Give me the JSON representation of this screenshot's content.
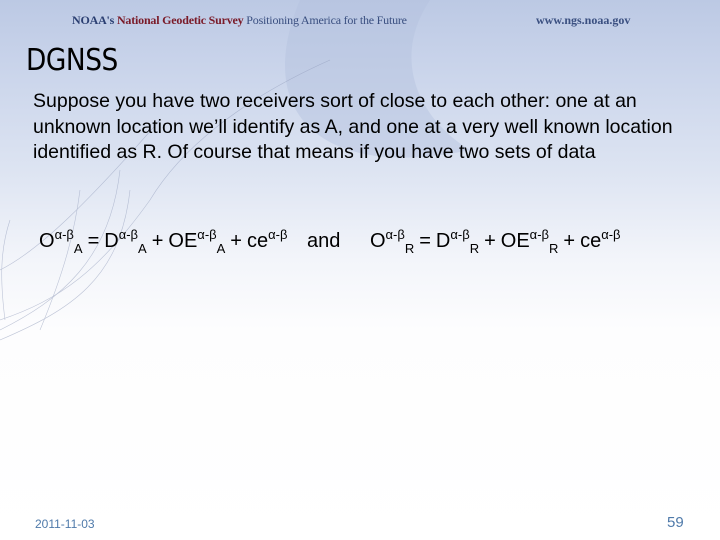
{
  "header": {
    "org_prefix": "NOAA's",
    "org_name": "National Geodetic Survey",
    "tagline": "Positioning America for the Future",
    "url": "www.ngs.noaa.gov"
  },
  "slide": {
    "title": "DGNSS",
    "body": "Suppose you have two receivers sort of close to each other: one at an unknown location we’ll identify as A, and one at a very well known location identified as R. Of course that means if you have two sets of data",
    "equations": {
      "conjunction": "and",
      "superscript": "α-β",
      "equals": "=",
      "plus": "+",
      "eq_a": {
        "subscript": "A",
        "terms": [
          "O",
          "D",
          "OE",
          "ce"
        ]
      },
      "eq_r": {
        "subscript": "R",
        "terms": [
          "O",
          "D",
          "OE",
          "ce"
        ]
      }
    }
  },
  "footer": {
    "date": "2011-11-03",
    "page_number": "59"
  },
  "colors": {
    "org_name": "#7a1a28",
    "banner_text": "#2b3f72",
    "footer_text": "#4f7aaa"
  }
}
